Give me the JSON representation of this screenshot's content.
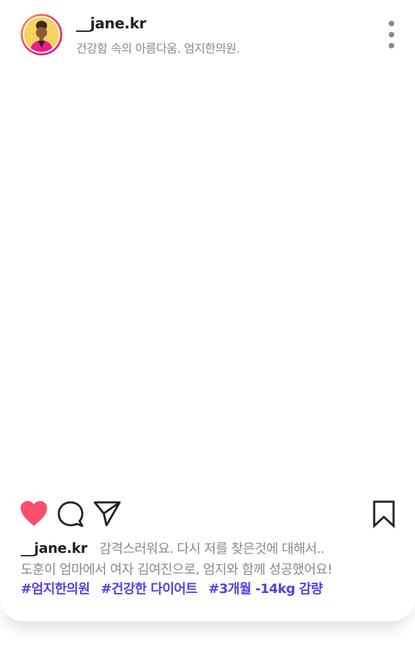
{
  "header": {
    "username": "__jane.kr",
    "bio": "건강함 속의 아름다움. 엄지한의원."
  },
  "icons": {
    "like": "heart-icon",
    "comment": "comment-icon",
    "share": "send-icon",
    "save": "bookmark-icon",
    "more": "more-vertical-icon"
  },
  "caption": {
    "username": "__jane.kr",
    "line1": "감격스러워요. 다시 저를 찾은것에 대해서..",
    "line2": "도훈이 엄마에서 여자 김여진으로, 엄지와 함께 성공했어요!"
  },
  "hashtags": [
    "#엄지한의원",
    "#건강한 다이어트",
    "#3개월 -14kg 감량"
  ],
  "colors": {
    "like": "#ff4d6d",
    "hashtag": "#5b3de8",
    "text_muted": "#8a8a8a",
    "text_primary": "#222222"
  }
}
